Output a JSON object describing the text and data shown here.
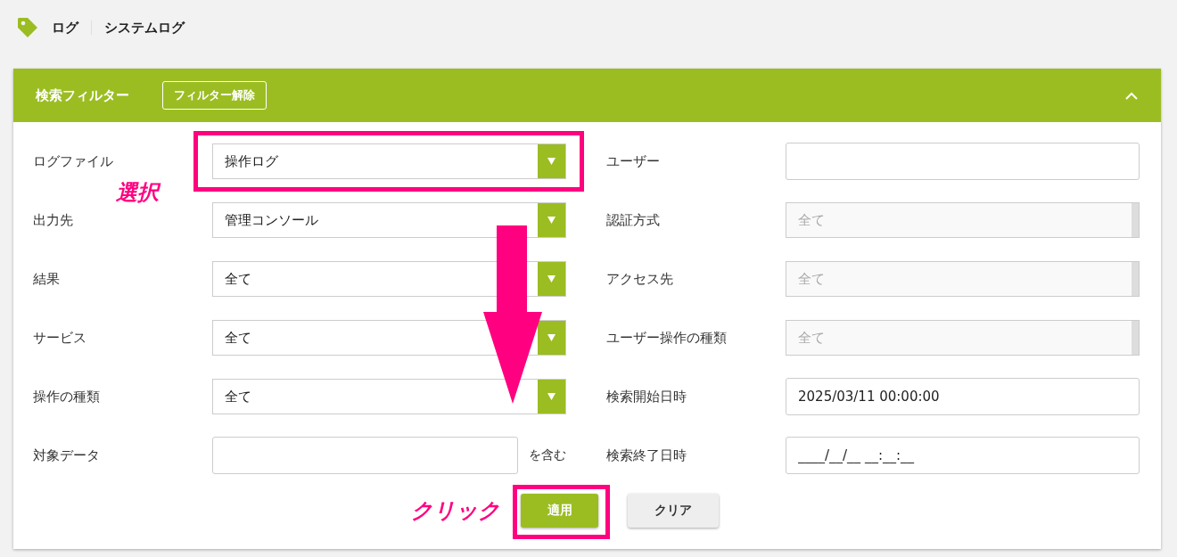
{
  "breadcrumb": [
    "ログ",
    "システムログ"
  ],
  "filter": {
    "title": "検索フィルター",
    "clear_filter_button": "フィルター解除",
    "expanded": true,
    "left_fields": [
      {
        "kind": "select",
        "label": "ログファイル",
        "value": "操作ログ",
        "disabled": false,
        "highlighted": true
      },
      {
        "kind": "select",
        "label": "出力先",
        "value": "管理コンソール",
        "disabled": false,
        "highlighted": false
      },
      {
        "kind": "select",
        "label": "結果",
        "value": "全て",
        "disabled": false,
        "highlighted": false
      },
      {
        "kind": "select",
        "label": "サービス",
        "value": "全て",
        "disabled": false,
        "highlighted": false
      },
      {
        "kind": "select",
        "label": "操作の種類",
        "value": "全て",
        "disabled": false,
        "highlighted": false
      },
      {
        "kind": "text",
        "label": "対象データ",
        "suffix": "を含む",
        "disabled": false,
        "highlighted": false
      }
    ],
    "right_fields": [
      {
        "kind": "text",
        "label": "ユーザー",
        "disabled": false,
        "highlighted": false
      },
      {
        "kind": "select",
        "label": "認証方式",
        "value": "全て",
        "disabled": true,
        "highlighted": false
      },
      {
        "kind": "select",
        "label": "アクセス先",
        "value": "全て",
        "disabled": true,
        "highlighted": false
      },
      {
        "kind": "select",
        "label": "ユーザー操作の種類",
        "value": "全て",
        "disabled": true,
        "highlighted": false
      },
      {
        "kind": "text",
        "label": "検索開始日時",
        "value": "2025/03/11 00:00:00",
        "disabled": false,
        "highlighted": false
      },
      {
        "kind": "text",
        "label": "検索終了日時",
        "value": "____/__/__ __:__:__",
        "disabled": false,
        "highlighted": false
      }
    ],
    "buttons": [
      {
        "label": "適用",
        "kind": "primary",
        "highlighted": true
      },
      {
        "label": "クリア",
        "kind": "secondary",
        "highlighted": false
      }
    ]
  },
  "annotations": {
    "select_note": "選択",
    "click_note": "クリック",
    "arrow": true
  }
}
